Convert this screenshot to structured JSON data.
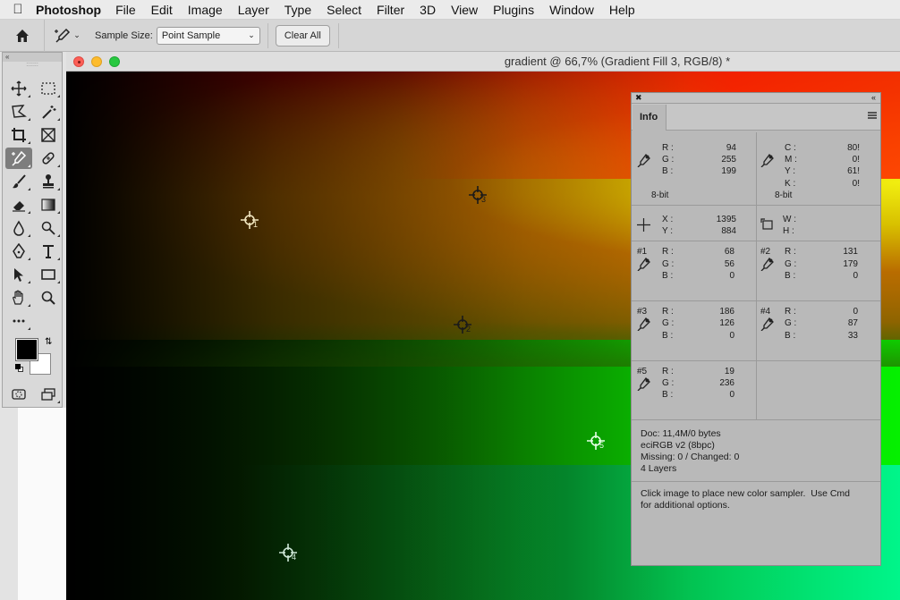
{
  "menubar": {
    "app": "Photoshop",
    "items": [
      "File",
      "Edit",
      "Image",
      "Layer",
      "Type",
      "Select",
      "Filter",
      "3D",
      "View",
      "Plugins",
      "Window",
      "Help"
    ]
  },
  "options": {
    "sample_size_label": "Sample Size:",
    "sample_size_value": "Point Sample",
    "clear_all": "Clear All"
  },
  "document": {
    "title": "gradient @ 66,7% (Gradient Fill 3, RGB/8) *"
  },
  "samplers": [
    {
      "id": "1",
      "color": "#f1e6c0"
    },
    {
      "id": "2",
      "color": "#1a1a1a"
    },
    {
      "id": "3",
      "color": "#1a1a1a"
    },
    {
      "id": "4",
      "color": "#cfe8d8"
    },
    {
      "id": "5",
      "color": "#e8ffe8"
    }
  ],
  "info": {
    "tab": "Info",
    "rgb": {
      "r_label": "R :",
      "g_label": "G :",
      "b_label": "B :",
      "r": "94",
      "g": "255",
      "b": "199",
      "depth": "8-bit"
    },
    "cmyk": {
      "c_label": "C :",
      "m_label": "M :",
      "y_label": "Y :",
      "k_label": "K :",
      "c": "80!",
      "m": "0!",
      "y": "61!",
      "k": "0!",
      "depth": "8-bit"
    },
    "coords": {
      "x_label": "X :",
      "y_label": "Y :",
      "x": "1395",
      "y": "884"
    },
    "size": {
      "w_label": "W :",
      "h_label": "H :"
    },
    "s1": {
      "tag": "#1",
      "r": "68",
      "g": "56",
      "b": "0"
    },
    "s2": {
      "tag": "#2",
      "r": "131",
      "g": "179",
      "b": "0"
    },
    "s3": {
      "tag": "#3",
      "r": "186",
      "g": "126",
      "b": "0"
    },
    "s4": {
      "tag": "#4",
      "r": "0",
      "g": "87",
      "b": "33"
    },
    "s5": {
      "tag": "#5",
      "r": "19",
      "g": "236",
      "b": "0"
    },
    "doc_lines": {
      "doc": "Doc: 11,4M/0 bytes",
      "profile": "eciRGB v2 (8bpc)",
      "missing": "Missing: 0 / Changed: 0",
      "layers": "4 Layers"
    },
    "hint": "Click image to place new color sampler.  Use Cmd\nfor additional options."
  }
}
